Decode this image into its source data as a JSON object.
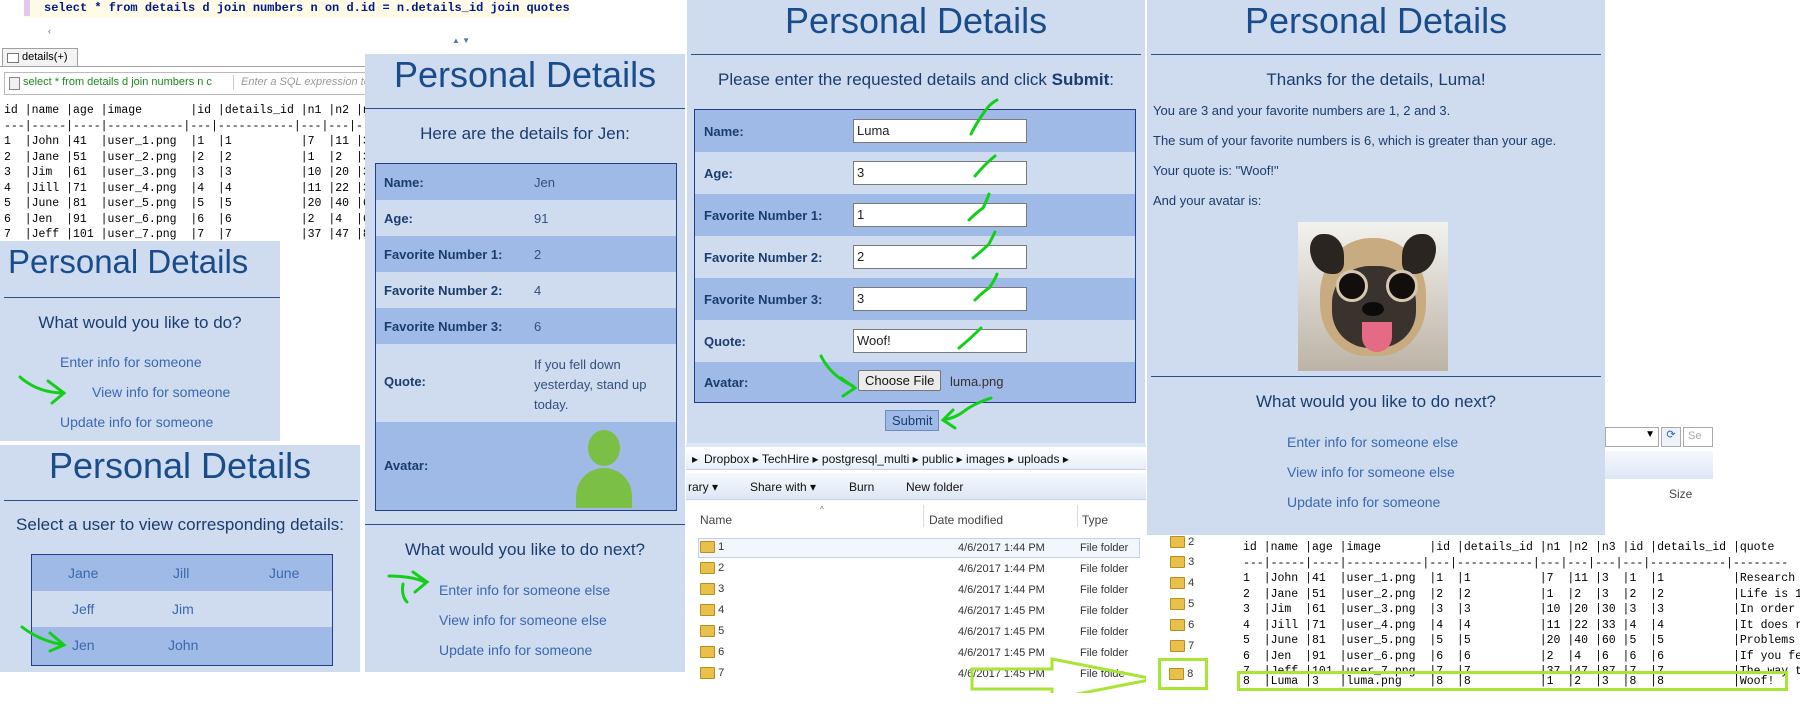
{
  "sql_editor": {
    "query": "select * from details d join numbers n on d.id = n.details_id join quotes q",
    "tab_label": "details(+)",
    "filter_query": "select * from details d join numbers n c",
    "filter_placeholder": "Enter a SQL expression to",
    "header": "id |name |age |image       |id |details_id |n1 |n2 |n",
    "separator": "---|-----|----|-----------|---|-----------|---|---|-",
    "rows": [
      "1  |John |41  |user_1.png  |1  |1          |7  |11 |3",
      "2  |Jane |51  |user_2.png  |2  |2          |1  |2  |3",
      "3  |Jim  |61  |user_3.png  |3  |3          |10 |20 |3",
      "4  |Jill |71  |user_4.png  |4  |4          |11 |22 |3",
      "5  |June |81  |user_5.png  |5  |5          |20 |40 |6",
      "6  |Jen  |91  |user_6.png  |6  |6          |2  |4  |6",
      "7  |Jeff |101 |user_7.png  |7  |7          |37 |47 |8"
    ]
  },
  "menu_panel": {
    "title": "Personal Details",
    "question": "What would you like to do?",
    "links": [
      "Enter info for someone",
      "View info for someone",
      "Update info for someone"
    ]
  },
  "select_panel": {
    "title": "Personal Details",
    "prompt": "Select a user to view corresponding details:",
    "users": [
      [
        "Jane",
        "Jill",
        "June"
      ],
      [
        "Jeff",
        "Jim",
        ""
      ],
      [
        "Jen",
        "John",
        ""
      ]
    ]
  },
  "view_panel": {
    "title": "Personal Details",
    "subtitle": "Here are the details for Jen:",
    "fields": [
      {
        "label": "Name:",
        "value": "Jen"
      },
      {
        "label": "Age:",
        "value": "91"
      },
      {
        "label": "Favorite Number 1:",
        "value": "2"
      },
      {
        "label": "Favorite Number 2:",
        "value": "4"
      },
      {
        "label": "Favorite Number 3:",
        "value": "6"
      },
      {
        "label": "Quote:",
        "value": "If you fell down yesterday, stand up today."
      },
      {
        "label": "Avatar:",
        "value": ""
      }
    ],
    "next_title": "What would you like to do next?",
    "links": [
      "Enter info for someone else",
      "View info for someone else",
      "Update info for someone"
    ]
  },
  "form_panel": {
    "title": "Personal Details",
    "instruction_prefix": "Please enter the requested details and click ",
    "instruction_bold": "Submit",
    "instruction_suffix": ":",
    "fields": [
      {
        "label": "Name:",
        "value": "Luma"
      },
      {
        "label": "Age:",
        "value": "3"
      },
      {
        "label": "Favorite Number 1:",
        "value": "1"
      },
      {
        "label": "Favorite Number 2:",
        "value": "2"
      },
      {
        "label": "Favorite Number 3:",
        "value": "3"
      },
      {
        "label": "Quote:",
        "value": "Woof!"
      }
    ],
    "avatar_label": "Avatar:",
    "choose_file": "Choose File",
    "file_name": "luma.png",
    "submit": "Submit"
  },
  "result_panel": {
    "title": "Personal Details",
    "thanks": "Thanks for the details, Luma!",
    "lines": [
      "You are 3 and your favorite numbers are 1, 2 and 3.",
      "The sum of your favorite numbers is 6, which is greater than your age.",
      "Your quote is: \"Woof!\"",
      "And your avatar is:"
    ],
    "next_title": "What would you like to do next?",
    "links": [
      "Enter info for someone else",
      "View info for someone else",
      "Update info for someone"
    ]
  },
  "explorer": {
    "breadcrumb": [
      "Dropbox",
      "TechHire",
      "postgresql_multi",
      "public",
      "images",
      "uploads"
    ],
    "toolbar": [
      "rary",
      "Share with",
      "Burn",
      "New folder"
    ],
    "columns": [
      "Name",
      "Date modified",
      "Type",
      "Size"
    ],
    "rows": [
      {
        "name": "1",
        "date": "4/6/2017 1:44 PM",
        "type": "File folder"
      },
      {
        "name": "2",
        "date": "4/6/2017 1:44 PM",
        "type": "File folder"
      },
      {
        "name": "3",
        "date": "4/6/2017 1:44 PM",
        "type": "File folder"
      },
      {
        "name": "4",
        "date": "4/6/2017 1:45 PM",
        "type": "File folder"
      },
      {
        "name": "5",
        "date": "4/6/2017 1:45 PM",
        "type": "File folder"
      },
      {
        "name": "6",
        "date": "4/6/2017 1:45 PM",
        "type": "File folder"
      },
      {
        "name": "7",
        "date": "4/6/2017 1:45 PM",
        "type": "File folde"
      }
    ],
    "side_folders": [
      "2",
      "3",
      "4",
      "5",
      "6",
      "7"
    ],
    "new_folder": "8",
    "search_stub": "Se"
  },
  "sql_result": {
    "header": "id |name |age |image       |id |details_id |n1 |n2 |n3 |id |details_id |quote",
    "separator": "---|-----|----|-----------|---|-----------|---|---|---|---|-----------|--------",
    "rows": [
      "1  |John |41  |user_1.png  |1  |1          |7  |11 |3  |1  |1          |Research",
      "2  |Jane |51  |user_2.png  |2  |2          |1  |2  |3  |2  |2          |Life is 1",
      "3  |Jim  |61  |user_3.png  |3  |3          |10 |20 |30 |3  |3          |In order",
      "4  |Jill |71  |user_4.png  |4  |4          |11 |22 |33 |4  |4          |It does r",
      "5  |June |81  |user_5.png  |5  |5          |20 |40 |60 |5  |5          |Problems",
      "6  |Jen  |91  |user_6.png  |6  |6          |2  |4  |6  |6  |6          |If you fe",
      "7  |Jeff |101 |user_7.png  |7  |7          |37 |47 |87 |7  |7          |The way t"
    ],
    "highlight_row": "8  |Luma |3   |luma.png    |8  |8          |1  |2  |3  |8  |8          |Woof!"
  },
  "colors": {
    "panel_bg": "#cfdcef",
    "title": "#1a4c8c",
    "row_dark": "#9fbae6",
    "link": "#3a68b0",
    "annotation_green": "#12d01a",
    "highlight_box": "#a8e636"
  }
}
